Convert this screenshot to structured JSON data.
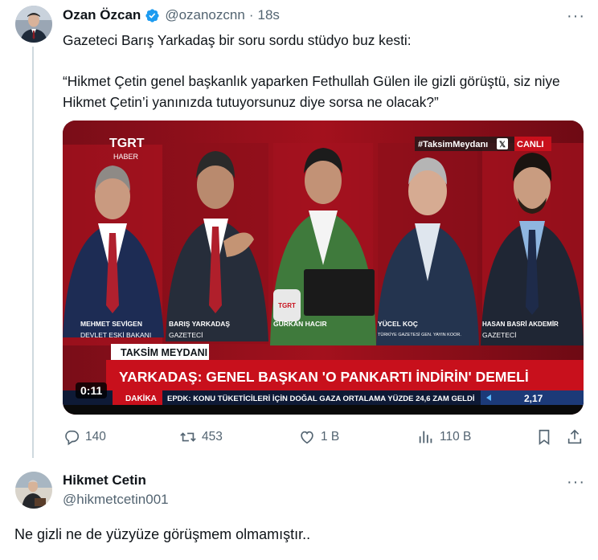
{
  "tweet": {
    "author_name": "Ozan Özcan",
    "author_handle": "@ozanozcnn",
    "separator": "·",
    "time": "18s",
    "paragraphs": [
      "Gazeteci Barış Yarkadaş bir soru sordu stüdyo buz kesti:",
      "“Hikmet Çetin genel başkanlık yaparken Fethullah Gülen ile gizli görüştü, siz niye Hikmet Çetin’i yanınızda tutuyorsunuz diye sorsa ne olacak?”"
    ]
  },
  "video": {
    "channel_logo": "TGRT",
    "channel_sub": "HABER",
    "hashtag": "#TaksimMeydanı",
    "live_label": "CANLI",
    "panelists": [
      {
        "name": "MEHMET SEVİGEN",
        "title": "DEVLET ESKİ BAKANI"
      },
      {
        "name": "BARIŞ YARKADAŞ",
        "title": "GAZETECİ"
      },
      {
        "name": "GÜRKAN HACIR",
        "title": ""
      },
      {
        "name": "YÜCEL KOÇ",
        "title": "TÜRKİYE GAZETESİ GEN. YAYIN KOOR."
      },
      {
        "name": "HASAN BASRİ AKDEMİR",
        "title": "GAZETECİ"
      }
    ],
    "program": "TAKSİM MEYDANI",
    "headline": "YARKADAŞ: GENEL BAŞKAN 'O PANKARTI İNDİRİN' DEMELİ",
    "ticker_label": "DAKİKA",
    "ticker_text": "EPDK: KONU TÜKETİCİLERİ İÇİN DOĞAL GAZA ORTALAMA YÜZDE 24,6 ZAM GELDİ",
    "ticker_value": "2,17",
    "duration": "0:11"
  },
  "actions": {
    "replies": "140",
    "reposts": "453",
    "likes": "1 B",
    "views": "110 B"
  },
  "reply": {
    "author_name": "Hikmet Cetin",
    "author_handle": "@hikmetcetin001",
    "text": "Ne gizli ne de yüzyüze görüşmem olmamıştır.."
  },
  "colors": {
    "accent": "#1d9bf0",
    "secondary_text": "#536471",
    "broadcast_red": "#c8101c"
  },
  "icons": [
    "more-icon",
    "verified-badge-icon",
    "reply-icon",
    "repost-icon",
    "like-icon",
    "views-icon",
    "bookmark-icon",
    "share-icon"
  ]
}
